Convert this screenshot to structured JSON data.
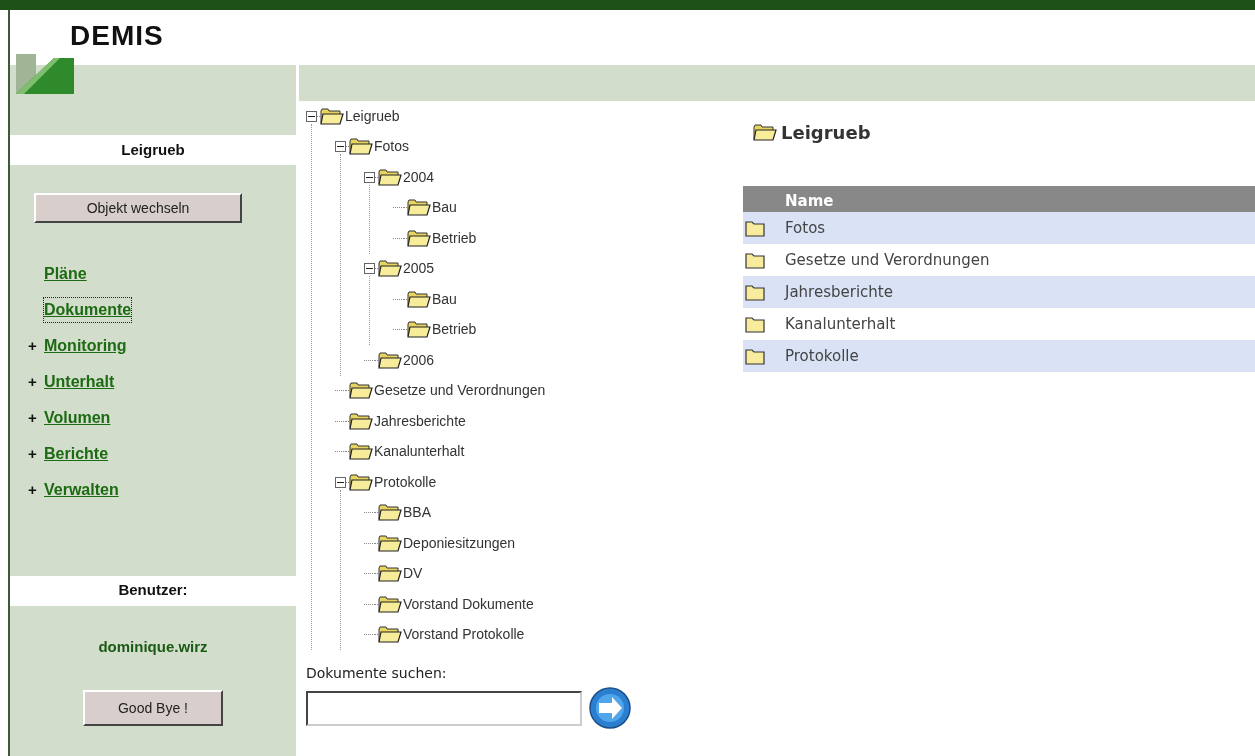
{
  "logo": {
    "text": "DEMIS"
  },
  "sidebar": {
    "object_name": "Leigrueb",
    "change_button": "Objekt wechseln",
    "nav": [
      {
        "label": "Pläne",
        "selected": false
      },
      {
        "label": "Dokumente",
        "selected": true
      },
      {
        "prefix": "+",
        "label": "Monitoring",
        "selected": false
      },
      {
        "prefix": "+",
        "label": "Unterhalt",
        "selected": false
      },
      {
        "prefix": "+",
        "label": "Volumen",
        "selected": false
      },
      {
        "prefix": "+",
        "label": "Berichte",
        "selected": false
      },
      {
        "prefix": "+",
        "label": "Verwalten",
        "selected": false
      }
    ],
    "user_heading": "Benutzer:",
    "user_name": "dominique.wirz",
    "logout_button": "Good Bye !"
  },
  "tree": [
    {
      "label": "Leigrueb",
      "expanded": true,
      "children": [
        {
          "label": "Fotos",
          "expanded": true,
          "children": [
            {
              "label": "2004",
              "expanded": true,
              "children": [
                {
                  "label": "Bau"
                },
                {
                  "label": "Betrieb"
                }
              ]
            },
            {
              "label": "2005",
              "expanded": true,
              "children": [
                {
                  "label": "Bau"
                },
                {
                  "label": "Betrieb"
                }
              ]
            },
            {
              "label": "2006"
            }
          ]
        },
        {
          "label": "Gesetze und Verordnungen"
        },
        {
          "label": "Jahresberichte"
        },
        {
          "label": "Kanalunterhalt"
        },
        {
          "label": "Protokolle",
          "expanded": true,
          "children": [
            {
              "label": "BBA"
            },
            {
              "label": "Deponiesitzungen"
            },
            {
              "label": "DV"
            },
            {
              "label": "Vorstand Dokumente"
            },
            {
              "label": "Vorstand Protokolle"
            }
          ]
        }
      ]
    }
  ],
  "search": {
    "label": "Dokumente suchen:"
  },
  "folder_view": {
    "title": "Leigrueb",
    "table": {
      "columns": [
        "Name"
      ],
      "rows": [
        {
          "name": "Fotos"
        },
        {
          "name": "Gesetze und Verordnungen"
        },
        {
          "name": "Jahresberichte"
        },
        {
          "name": "Kanalunterhalt"
        },
        {
          "name": "Protokolle"
        }
      ]
    }
  }
}
